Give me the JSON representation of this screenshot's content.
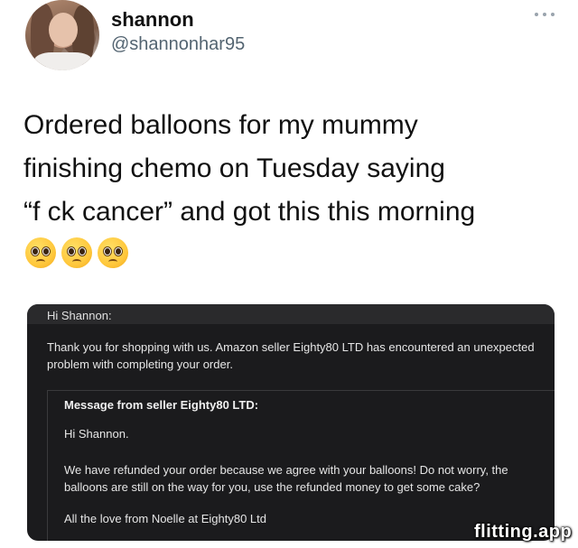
{
  "user": {
    "display_name": "shannon",
    "handle": "@shannonhar95"
  },
  "tweet": {
    "text": "Ordered balloons for my mummy\nfinishing chemo on Tuesday saying\n“f  ck cancer” and got this this morning",
    "emojis": [
      "pleading-face-emoji",
      "pleading-face-emoji",
      "pleading-face-emoji"
    ]
  },
  "email": {
    "greeting": "Hi Shannon:",
    "body_line1": "Thank you for shopping with us. Amazon seller Eighty80 LTD has encountered an unexpected",
    "body_line2": "problem with completing your order.",
    "seller": {
      "title": "Message from seller Eighty80 LTD:",
      "greeting": "Hi Shannon.",
      "message": "We have refunded your order because we agree with your balloons! Do not worry, the balloons are still on the way for you, use the refunded money to get some cake?",
      "signoff": "All the love from Noelle at Eighty80 Ltd"
    }
  },
  "watermark": "flitting.app",
  "colors": {
    "handle": "#536471",
    "card_background": "#1b1b1d"
  }
}
